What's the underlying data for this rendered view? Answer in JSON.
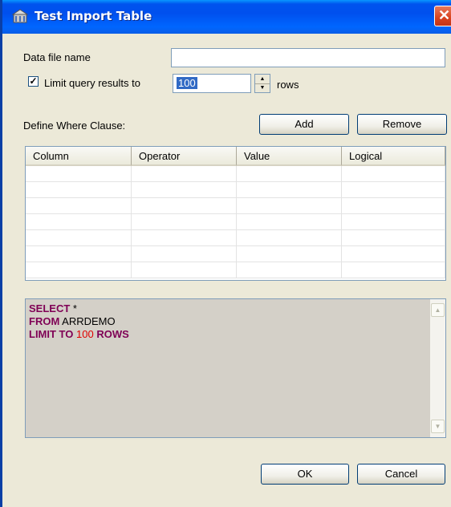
{
  "window": {
    "title": "Test Import Table",
    "close_glyph": "✕"
  },
  "form": {
    "data_file_label": "Data file name",
    "data_file_value": "",
    "limit_label": "Limit query results to",
    "limit_checked": true,
    "limit_value": "100",
    "rows_label": "rows",
    "where_label": "Define Where Clause:",
    "add_label": "Add",
    "remove_label": "Remove"
  },
  "grid": {
    "columns": [
      "Column",
      "Operator",
      "Value",
      "Logical"
    ],
    "rows": []
  },
  "sql": {
    "line1_kw": "SELECT",
    "line1_rest": " *",
    "line2_kw": "FROM",
    "line2_rest": " ARRDEMO",
    "line3_kw_a": "LIMIT TO",
    "line3_num": "100",
    "line3_kw_b": "ROWS"
  },
  "footer": {
    "ok_label": "OK",
    "cancel_label": "Cancel"
  },
  "icons": {
    "title": "building-icon",
    "close": "close-icon",
    "check": "checkmark-icon",
    "spin_up": "triangle-up-icon",
    "spin_down": "triangle-down-icon",
    "scroll_up": "chevron-up-icon",
    "scroll_down": "chevron-down-icon"
  },
  "colors": {
    "titlebar": "#0053ee",
    "keyword": "#7f0055",
    "number": "#e00000",
    "dialog_bg": "#ece9d8"
  }
}
